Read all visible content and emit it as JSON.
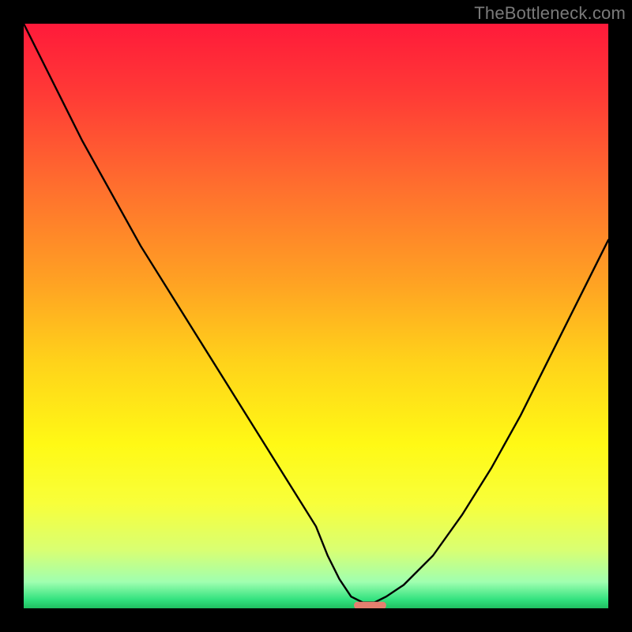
{
  "watermark": "TheBottleneck.com",
  "chart_data": {
    "type": "line",
    "title": "",
    "xlabel": "",
    "ylabel": "",
    "xlim": [
      0,
      100
    ],
    "ylim": [
      0,
      100
    ],
    "x": [
      0,
      5,
      10,
      15,
      20,
      25,
      30,
      35,
      40,
      45,
      50,
      52,
      54,
      56,
      58,
      60,
      62,
      65,
      70,
      75,
      80,
      85,
      90,
      95,
      100
    ],
    "values": [
      100,
      90,
      80,
      71,
      62,
      54,
      46,
      38,
      30,
      22,
      14,
      9,
      5,
      2,
      1,
      1,
      2,
      4,
      9,
      16,
      24,
      33,
      43,
      53,
      63
    ],
    "minimum_x": 59,
    "minimum_marker": {
      "x_range": [
        56.5,
        62
      ],
      "y": 0.5,
      "color": "#e57f6f"
    },
    "background_gradient_stops": [
      {
        "offset": 0.0,
        "color": "#ff1a3a"
      },
      {
        "offset": 0.12,
        "color": "#ff3a36"
      },
      {
        "offset": 0.28,
        "color": "#ff6f2e"
      },
      {
        "offset": 0.44,
        "color": "#ffa123"
      },
      {
        "offset": 0.58,
        "color": "#ffd31a"
      },
      {
        "offset": 0.72,
        "color": "#fff915"
      },
      {
        "offset": 0.82,
        "color": "#f8ff3a"
      },
      {
        "offset": 0.9,
        "color": "#d9ff72"
      },
      {
        "offset": 0.955,
        "color": "#a0ffb0"
      },
      {
        "offset": 0.985,
        "color": "#33e27f"
      },
      {
        "offset": 1.0,
        "color": "#1fbf61"
      }
    ]
  }
}
